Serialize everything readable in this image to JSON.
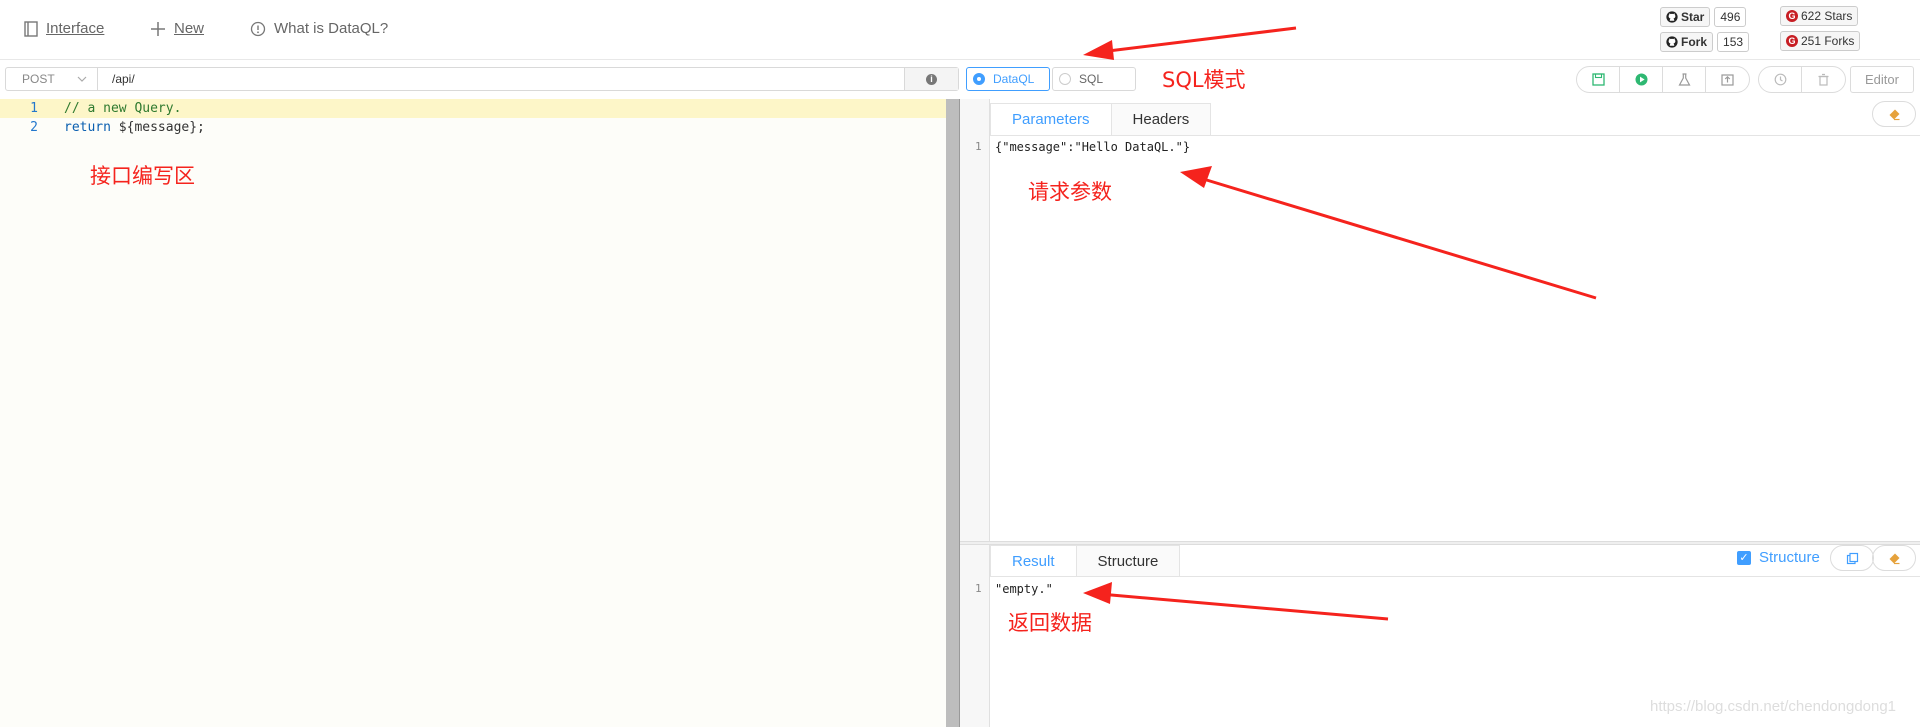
{
  "nav": {
    "interface": "Interface",
    "new": "New",
    "what_is": "What is DataQL?"
  },
  "badges": {
    "github_star": "Star",
    "github_star_count": "496",
    "github_fork": "Fork",
    "github_fork_count": "153",
    "gitee_stars": "622 Stars",
    "gitee_forks": "251 Forks"
  },
  "request": {
    "method": "POST",
    "url": "/api/"
  },
  "modes": [
    "DataQL",
    "SQL"
  ],
  "selected_mode": "DataQL",
  "toolbar": {
    "editor_label": "Editor"
  },
  "editor": {
    "lines": [
      {
        "num": "1",
        "text": "// a new Query."
      },
      {
        "num": "2",
        "keyword": "return",
        "rest": " ${message};"
      }
    ]
  },
  "params_panel": {
    "tabs": [
      "Parameters",
      "Headers"
    ],
    "active_tab": "Parameters",
    "line_num": "1",
    "content": "{\"message\":\"Hello DataQL.\"}"
  },
  "result_panel": {
    "tabs": [
      "Result",
      "Structure"
    ],
    "active_tab": "Result",
    "structure_check_label": "Structure",
    "line_num": "1",
    "content": "\"empty.\""
  },
  "annotations": {
    "sql_mode": "SQL模式",
    "editor_area": "接口编写区",
    "request_params": "请求参数",
    "return_data": "返回数据"
  },
  "watermark": "https://blog.csdn.net/chendongdong1",
  "colors": {
    "accent": "#409eff",
    "annotation": "#f5231d",
    "run": "#2eb872",
    "save": "#2eb872"
  }
}
